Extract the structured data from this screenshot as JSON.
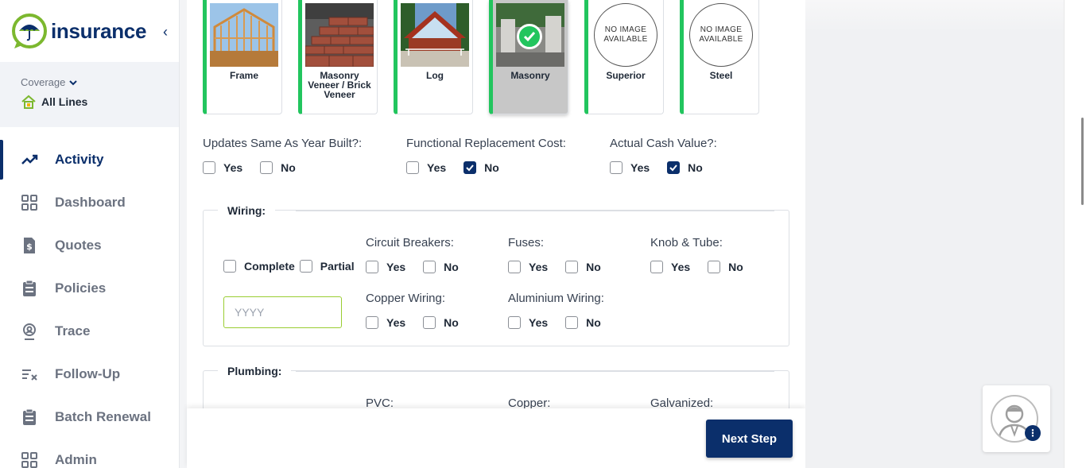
{
  "brand": {
    "logo_text": "insurance",
    "accent": "#0b2f6b",
    "green": "#22c55e"
  },
  "sidebar": {
    "coverage_label": "Coverage",
    "coverage_value": "All Lines",
    "items": [
      {
        "label": "Activity",
        "icon": "trend-icon",
        "active": true
      },
      {
        "label": "Dashboard",
        "icon": "grid-icon"
      },
      {
        "label": "Quotes",
        "icon": "dollar-doc-icon"
      },
      {
        "label": "Policies",
        "icon": "clipboard-icon"
      },
      {
        "label": "Trace",
        "icon": "location-pin-icon"
      },
      {
        "label": "Follow-Up",
        "icon": "list-check-icon"
      },
      {
        "label": "Batch Renewal",
        "icon": "clipboard-icon"
      },
      {
        "label": "Admin",
        "icon": "grid-icon"
      }
    ]
  },
  "construction": {
    "cards": [
      {
        "label": "Frame",
        "image": "frame-house-image"
      },
      {
        "label": "Masonry Veneer / Brick Veneer",
        "image": "brick-image"
      },
      {
        "label": "Log",
        "image": "log-house-image"
      },
      {
        "label": "Masonry",
        "image": "masonry-image",
        "selected": true
      },
      {
        "label": "Superior",
        "no_image": "NO IMAGE AVAILABLE"
      },
      {
        "label": "Steel",
        "no_image": "NO IMAGE AVAILABLE"
      }
    ]
  },
  "questions": {
    "updates_same": {
      "label": "Updates Same As Year Built?:",
      "yes": "Yes",
      "no": "No",
      "value": null
    },
    "functional_replacement": {
      "label": "Functional Replacement Cost:",
      "yes": "Yes",
      "no": "No",
      "value": "No"
    },
    "actual_cash_value": {
      "label": "Actual Cash Value?:",
      "yes": "Yes",
      "no": "No",
      "value": "No"
    }
  },
  "wiring": {
    "legend": "Wiring:",
    "complete": "Complete",
    "partial": "Partial",
    "year_placeholder": "YYYY",
    "circuit_breakers": "Circuit Breakers:",
    "fuses": "Fuses:",
    "knob_tube": "Knob & Tube:",
    "copper_wiring": "Copper Wiring:",
    "aluminium_wiring": "Aluminium Wiring:",
    "yes": "Yes",
    "no": "No"
  },
  "plumbing": {
    "legend": "Plumbing:",
    "pvc": "PVC:",
    "copper": "Copper:",
    "galvanized": "Galvanized:"
  },
  "footer": {
    "next_label": "Next Step"
  },
  "chat": {
    "badge": "⋮"
  }
}
